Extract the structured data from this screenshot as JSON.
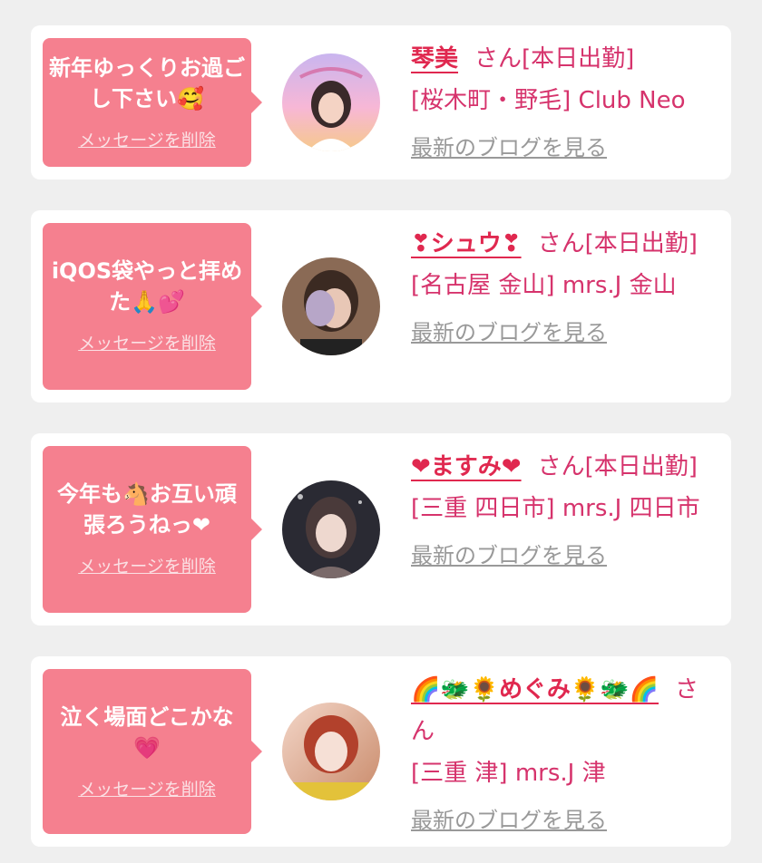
{
  "colors": {
    "page_bg": "#efefef",
    "card_bg": "#ffffff",
    "bubble_bg": "#f5808f",
    "accent_pink": "#d6336c",
    "name_red": "#e0284f",
    "link_gray": "#999999"
  },
  "delete_label": "メッセージを削除",
  "blog_label": "最新のブログを見る",
  "entries": [
    {
      "message": "新年ゆっくりお過ごし下さい🥰",
      "name": "琴美",
      "suffix": "さん[本日出勤]",
      "shop": "[桜木町・野毛] Club Neo",
      "avatar": "photo-avatar-sunset"
    },
    {
      "message": "iQOS袋やっと拝めた🙏💕",
      "name": "❣シュウ❣",
      "suffix": "さん[本日出勤]",
      "shop": "[名古屋 金山] mrs.J 金山",
      "avatar": "photo-avatar-hand"
    },
    {
      "message": "今年も🐴お互い頑張ろうねっ❤",
      "name": "❤ますみ❤",
      "suffix": "さん[本日出勤]",
      "shop": "[三重 四日市] mrs.J 四日市",
      "avatar": "photo-avatar-night"
    },
    {
      "message": "泣く場面どこかな💗",
      "name": "🌈🐲🌻めぐみ🌻🐲🌈",
      "suffix": "さん",
      "shop": "[三重 津] mrs.J 津",
      "avatar": "photo-avatar-smile"
    }
  ]
}
